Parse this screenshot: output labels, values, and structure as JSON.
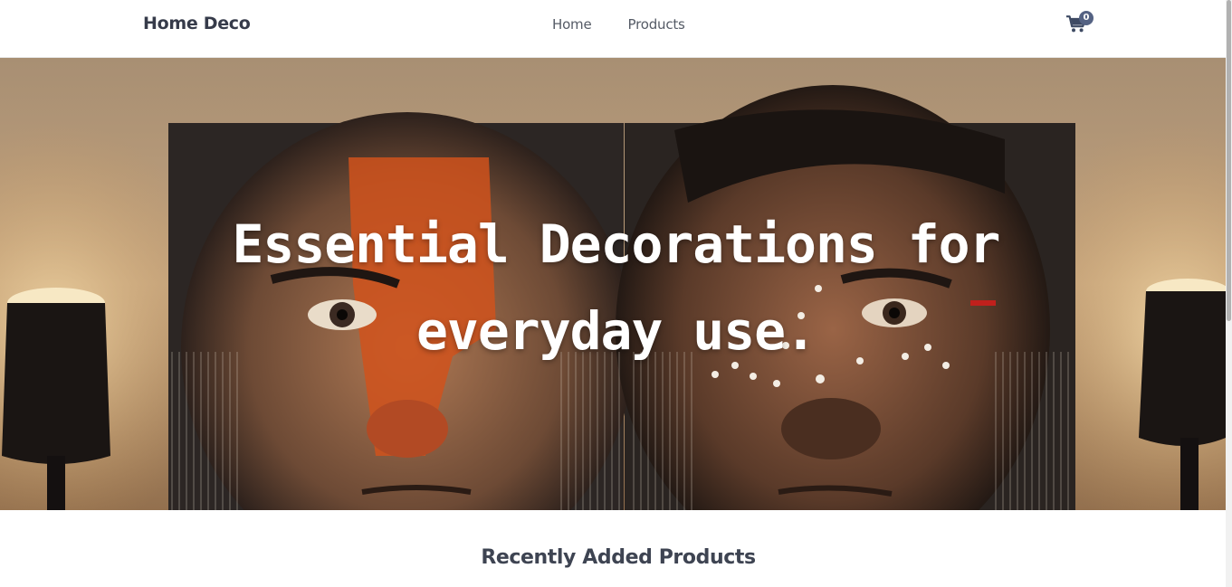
{
  "navbar": {
    "brand": "Home Deco",
    "links": [
      "Home",
      "Products"
    ],
    "cart": {
      "icon": "shopping-cart-icon",
      "count": "0",
      "badge_color": "#546283"
    }
  },
  "hero": {
    "title_line1": "Essential Decorations for",
    "title_line2": "everyday use."
  },
  "section": {
    "title": "Recently Added Products"
  },
  "colors": {
    "brand_text": "#363b4a",
    "nav_text": "#555b66",
    "hero_text": "#ffffff"
  }
}
